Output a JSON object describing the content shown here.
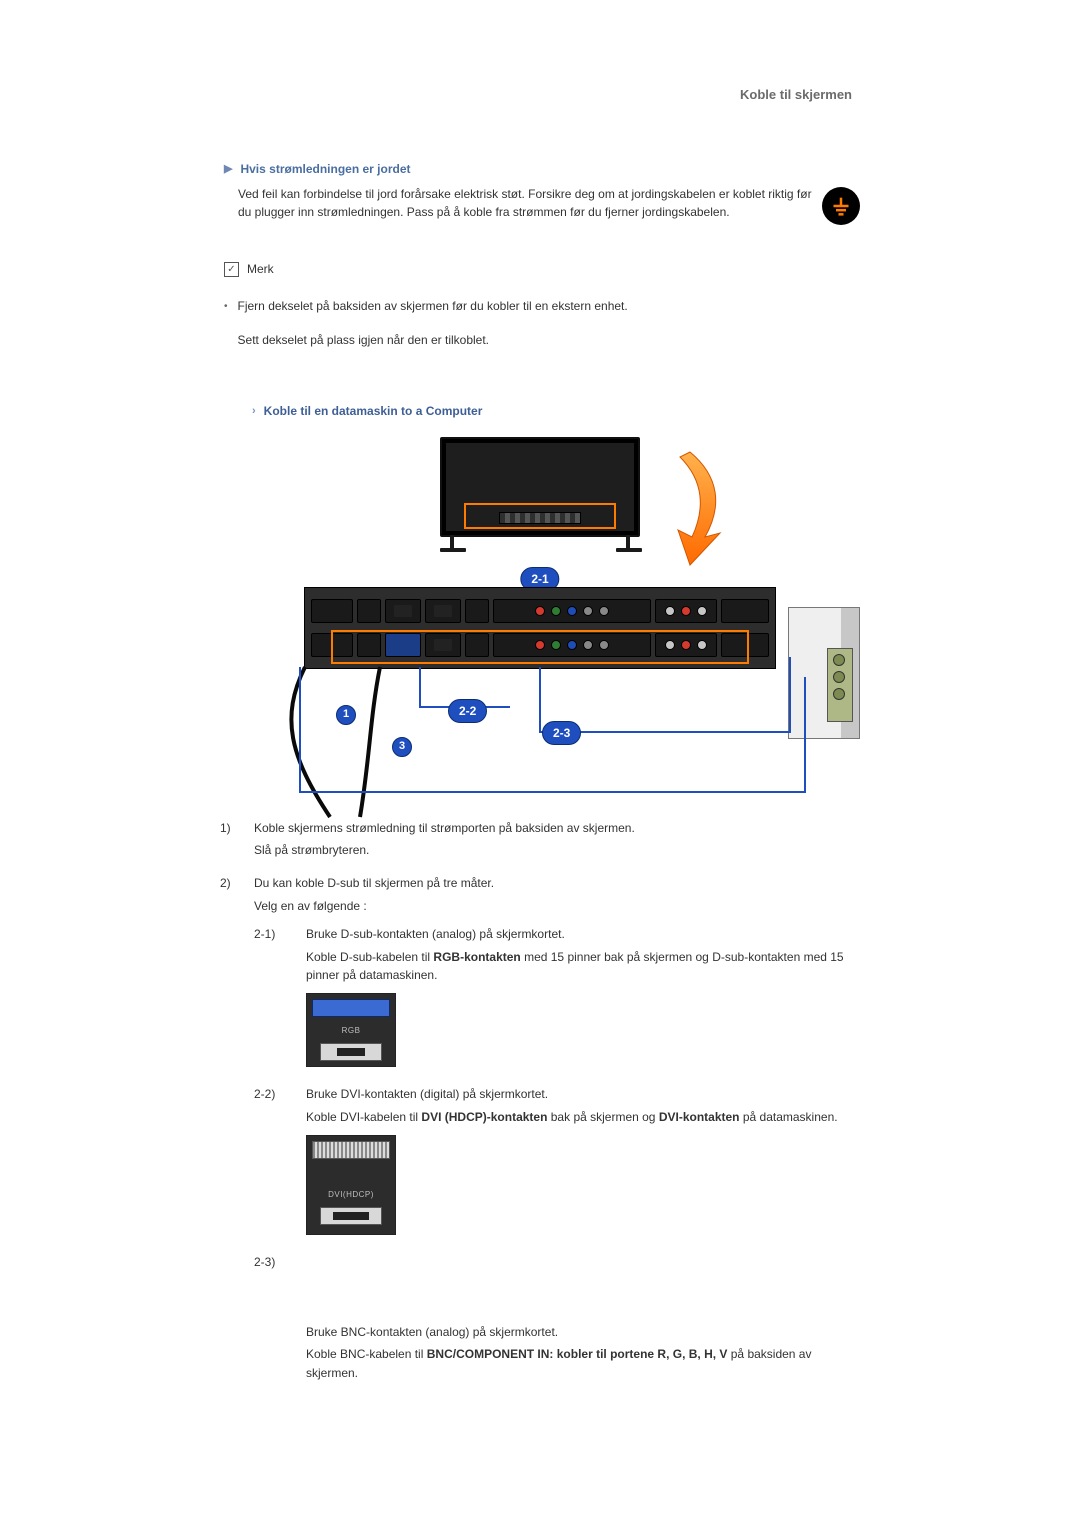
{
  "page_title": "Koble til skjermen",
  "ground": {
    "heading": "Hvis strømledningen er jordet",
    "body": "Ved feil kan forbindelse til jord forårsake elektrisk støt. Forsikre deg om at jordingskabelen er koblet riktig før du plugger inn strømledningen. Pass på å koble fra strømmen før du fjerner jordingskabelen."
  },
  "note": {
    "label": "Merk",
    "bullet1": "Fjern dekselet på baksiden av skjermen før du kobler til en ekstern enhet.",
    "bullet2": "Sett dekselet på plass igjen når den er tilkoblet."
  },
  "section2": {
    "heading": "Koble til en datamaskin to a Computer"
  },
  "diagram": {
    "label_21": "2-1",
    "label_22": "2-2",
    "label_23": "2-3",
    "label_1": "1",
    "label_3": "3"
  },
  "steps": {
    "s1_num": "1)",
    "s1_a": "Koble skjermens strømledning til strømporten på baksiden av skjermen.",
    "s1_b": "Slå på strømbryteren.",
    "s2_num": "2)",
    "s2_a": "Du kan koble D-sub til skjermen på tre måter.",
    "s2_b": "Velg en av følgende :",
    "s21_num": "2-1)",
    "s21_a": "Bruke D-sub-kontakten (analog) på skjermkortet.",
    "s21_b_pre": "Koble D-sub-kabelen til ",
    "s21_b_bold": "RGB-kontakten",
    "s21_b_post": " med 15 pinner bak på skjermen og D-sub-kontakten med 15 pinner på datamaskinen.",
    "s21_label": "RGB",
    "s22_num": "2-2)",
    "s22_a": "Bruke DVI-kontakten (digital) på skjermkortet.",
    "s22_b_pre": "Koble DVI-kabelen til ",
    "s22_b_bold1": "DVI (HDCP)-kontakten",
    "s22_b_mid": " bak på skjermen og ",
    "s22_b_bold2": "DVI-kontakten",
    "s22_b_post": " på datamaskinen.",
    "s22_label": "DVI(HDCP)",
    "s23_num": "2-3)",
    "s23_a": "Bruke BNC-kontakten (analog) på skjermkortet.",
    "s23_b_pre": "Koble BNC-kabelen til ",
    "s23_b_bold": "BNC/COMPONENT IN: kobler til portene R, G, B, H, V",
    "s23_b_post": " på baksiden av skjermen."
  }
}
